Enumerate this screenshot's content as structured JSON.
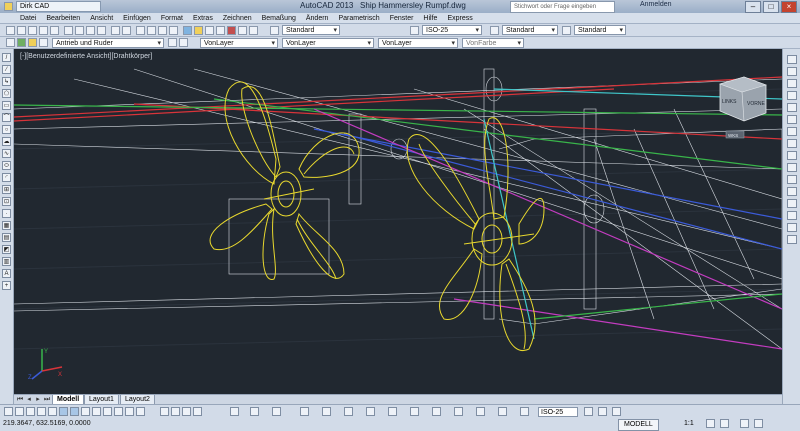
{
  "titlebar": {
    "workspace": "Dirk CAD",
    "app_title": "AutoCAD 2013",
    "file_name": "Ship Hammersley Rumpf.dwg",
    "search_placeholder": "Stichwort oder Frage eingeben",
    "login_label": "Anmelden"
  },
  "menu": [
    "Datei",
    "Bearbeiten",
    "Ansicht",
    "Einfügen",
    "Format",
    "Extras",
    "Zeichnen",
    "Bemaßung",
    "Ändern",
    "Parametrisch",
    "Fenster",
    "Hilfe",
    "Express"
  ],
  "toolbar1": {
    "text_style": "Standard",
    "dim_style": "ISO-25",
    "table_style": "Standard",
    "mleader_style": "Standard"
  },
  "toolbar2": {
    "layer": "Antrieb und Ruder",
    "color": "VonLayer",
    "linetype": "VonLayer",
    "lineweight": "VonLayer",
    "plotstyle": "VonFarbe"
  },
  "viewport": {
    "label": "[-][Benutzerdefinierte Ansicht][Drahtkörper]",
    "viewcube_left": "LINKS",
    "viewcube_front": "VORNE",
    "wcs_label": "WKS",
    "bg_color": "#212830"
  },
  "layout_tabs": [
    "Modell",
    "Layout1",
    "Layout2"
  ],
  "status": {
    "coordinates": "219.3647, 632.5169, 0.0000",
    "model": "MODELL",
    "scale": "1:1",
    "anno_scale": "ISO-25"
  },
  "colors": {
    "propeller": "#e8d82e",
    "hull_white": "#d8dde3",
    "layer_red": "#d8343a",
    "layer_green": "#39b54a",
    "layer_blue": "#3b5bd9",
    "layer_magenta": "#c33cc0",
    "layer_cyan": "#3fc6c9"
  }
}
